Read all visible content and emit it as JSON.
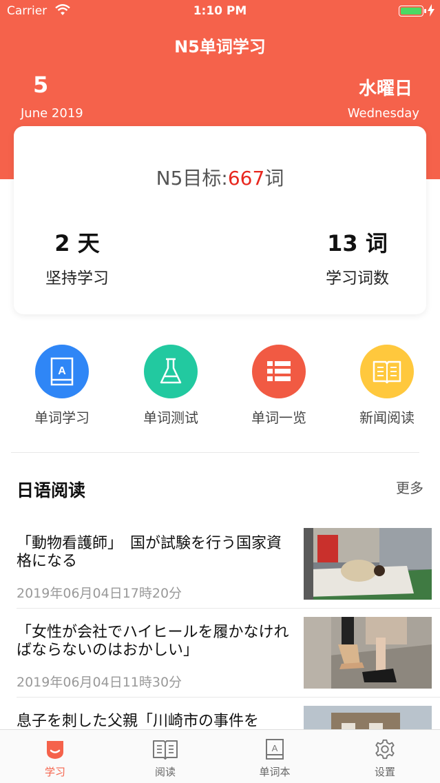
{
  "status_bar": {
    "carrier": "Carrier",
    "time": "1:10 PM"
  },
  "header": {
    "title": "N5单词学习",
    "day": "5",
    "month_year": "June 2019",
    "weekday_jp": "水曜日",
    "weekday_en": "Wednesday"
  },
  "goal_card": {
    "goal_prefix": "N5目标:",
    "goal_count": "667",
    "goal_suffix": "词",
    "streak_value": "2 天",
    "streak_label": "坚持学习",
    "words_value": "13 词",
    "words_label": "学习词数"
  },
  "menu": {
    "items": [
      {
        "label": "单词学习",
        "icon": "vocab-book-icon",
        "color": "#2f86f6"
      },
      {
        "label": "单词测试",
        "icon": "flask-icon",
        "color": "#22c9a0"
      },
      {
        "label": "单词一览",
        "icon": "list-icon",
        "color": "#f15a43"
      },
      {
        "label": "新闻阅读",
        "icon": "open-book-icon",
        "color": "#ffc83d"
      }
    ]
  },
  "reading": {
    "title": "日语阅读",
    "more": "更多",
    "articles": [
      {
        "headline": "「動物看護師」　国が試験を行う国家資格になる",
        "date": "2019年06月04日17時20分"
      },
      {
        "headline": "「女性が会社でハイヒールを履かなければならないのはおかしい」",
        "date": "2019年06月04日11時30分"
      },
      {
        "headline": "息子を刺した父親「川崎市の事件を",
        "date": ""
      }
    ]
  },
  "tabbar": {
    "tabs": [
      {
        "label": "学习",
        "active": true
      },
      {
        "label": "阅读",
        "active": false
      },
      {
        "label": "单词本",
        "active": false
      },
      {
        "label": "设置",
        "active": false
      }
    ]
  },
  "colors": {
    "accent": "#f5624b",
    "goal_number": "#e8271e"
  }
}
